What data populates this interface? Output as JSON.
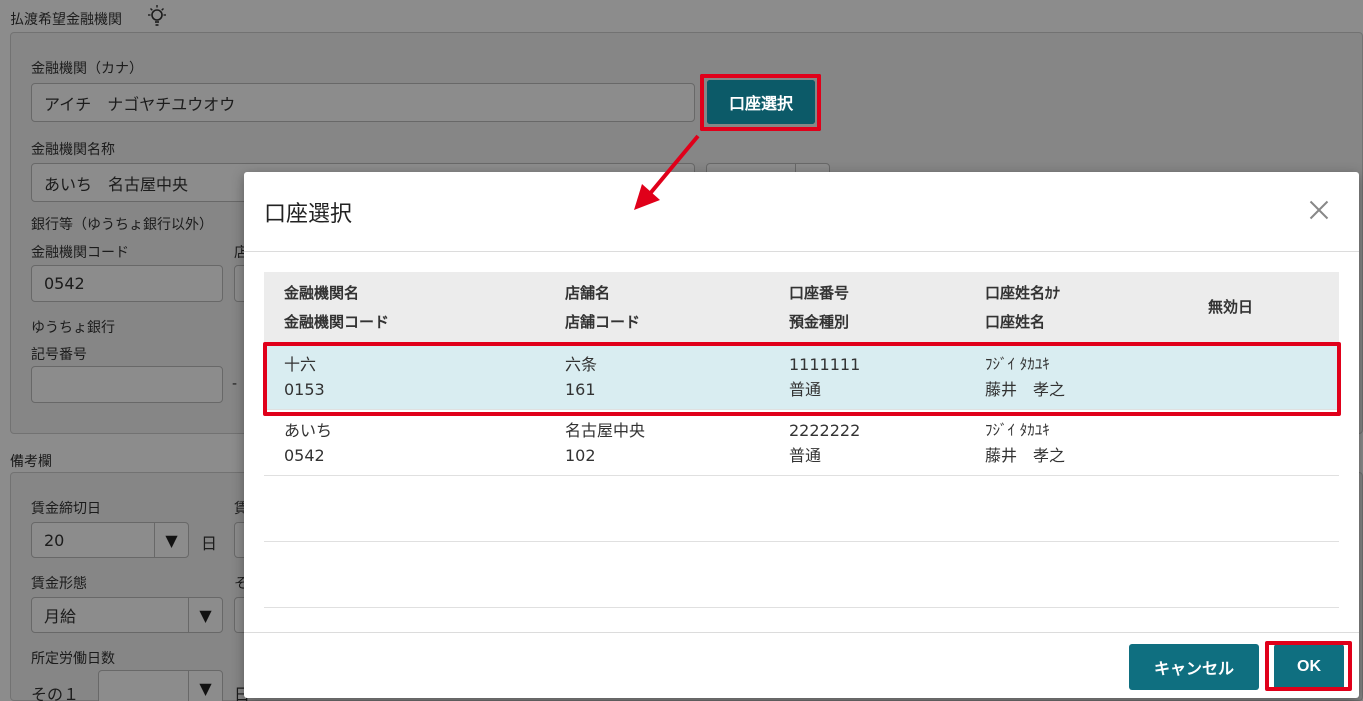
{
  "form": {
    "section_payment": "払渡希望金融機関",
    "bank_kana_label": "金融機関（カナ）",
    "bank_kana_value": "アイチ　ナゴヤチユウオウ",
    "account_select_button": "口座選択",
    "bank_name_label": "金融機関名称",
    "bank_name_value": "あいち　名古屋中央",
    "bank_other_label": "銀行等（ゆうちょ銀行以外）",
    "bank_code_label": "金融機関コード",
    "bank_code_value": "0542",
    "branch_label_partial": "店",
    "yucho_label": "ゆうちょ銀行",
    "symbol_number_label": "記号番号",
    "symbol_dash": "-",
    "section_remarks": "備考欄",
    "wage_cutoff_label": "賃金締切日",
    "wage_cutoff_value": "20",
    "day_unit": "日",
    "wage_pay_partial": "賃",
    "wage_type_label": "賃金形態",
    "wage_type_value": "月給",
    "other_partial": "そ",
    "work_days_label": "所定労働日数",
    "work_days_sub": "その１",
    "work_days_unit_partial": "日"
  },
  "modal": {
    "title": "口座選択",
    "headers": [
      {
        "line1": "金融機関名",
        "line2": "金融機関コード"
      },
      {
        "line1": "店舗名",
        "line2": "店舗コード"
      },
      {
        "line1": "口座番号",
        "line2": "預金種別"
      },
      {
        "line1": "口座姓名ｶﾅ",
        "line2": "口座姓名"
      },
      {
        "line1": "無効日",
        "line2": ""
      }
    ],
    "rows": [
      {
        "bank": "十六",
        "bank_code": "0153",
        "branch": "六条",
        "branch_code": "161",
        "account_no": "1111111",
        "account_type": "普通",
        "name_kana": "ﾌｼﾞｲ ﾀｶﾕｷ",
        "name": "藤井　孝之",
        "selected": true
      },
      {
        "bank": "あいち",
        "bank_code": "0542",
        "branch": "名古屋中央",
        "branch_code": "102",
        "account_no": "2222222",
        "account_type": "普通",
        "name_kana": "ﾌｼﾞｲ ﾀｶﾕｷ",
        "name": "藤井　孝之",
        "selected": false
      }
    ],
    "cancel_button": "キャンセル",
    "ok_button": "OK"
  },
  "colors": {
    "accent": "#0f6f80",
    "highlight": "#e0001a",
    "selected_row": "#d9edf1"
  }
}
